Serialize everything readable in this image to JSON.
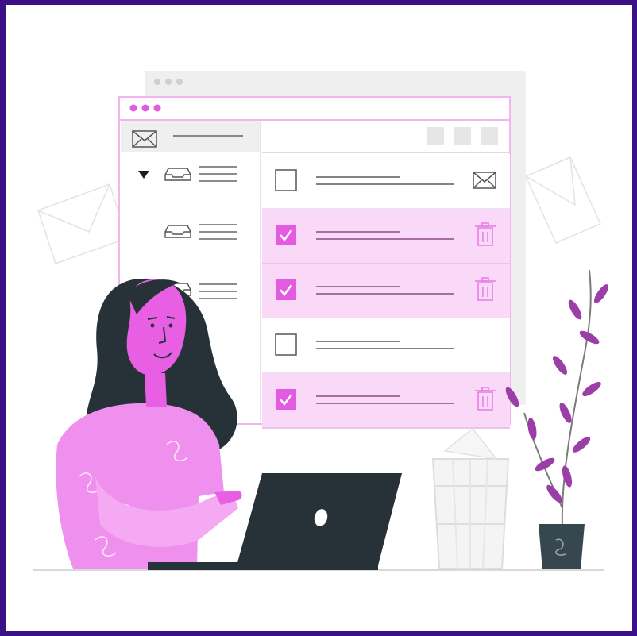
{
  "colors": {
    "frame": "#3b0f86",
    "accent": "#e879e8",
    "accent_light": "#f9d9f7",
    "accent_dark": "#b040b0",
    "checked_box": "#e25be0",
    "panel_gray": "#f2f2f2",
    "line_gray": "#5a5a5a",
    "hair": "#263238",
    "laptop": "#263238",
    "plant": "#9c3ea8"
  },
  "icons": {
    "back_window_dots": "three-dots-icon",
    "front_window_dots": "three-dots-icon",
    "sidebar_header": "mail-envelope-icon",
    "folders": [
      "inbox-tray-icon",
      "inbox-tray-icon",
      "inbox-tray-icon"
    ],
    "expand": "triangle-down-icon",
    "toolbar": [
      "square-button-icon",
      "square-button-icon",
      "square-button-icon"
    ]
  },
  "mail_rows": [
    {
      "checked": false,
      "selected": false,
      "action_icon": "mail-envelope-icon"
    },
    {
      "checked": true,
      "selected": true,
      "action_icon": "trash-icon"
    },
    {
      "checked": true,
      "selected": true,
      "action_icon": "trash-icon"
    },
    {
      "checked": false,
      "selected": false,
      "action_icon": "none"
    },
    {
      "checked": true,
      "selected": true,
      "action_icon": "trash-icon"
    }
  ],
  "decor": {
    "person": "woman-at-laptop",
    "wastebasket": "wire-basket",
    "plant": "potted-plant",
    "background_envelopes": 2
  }
}
